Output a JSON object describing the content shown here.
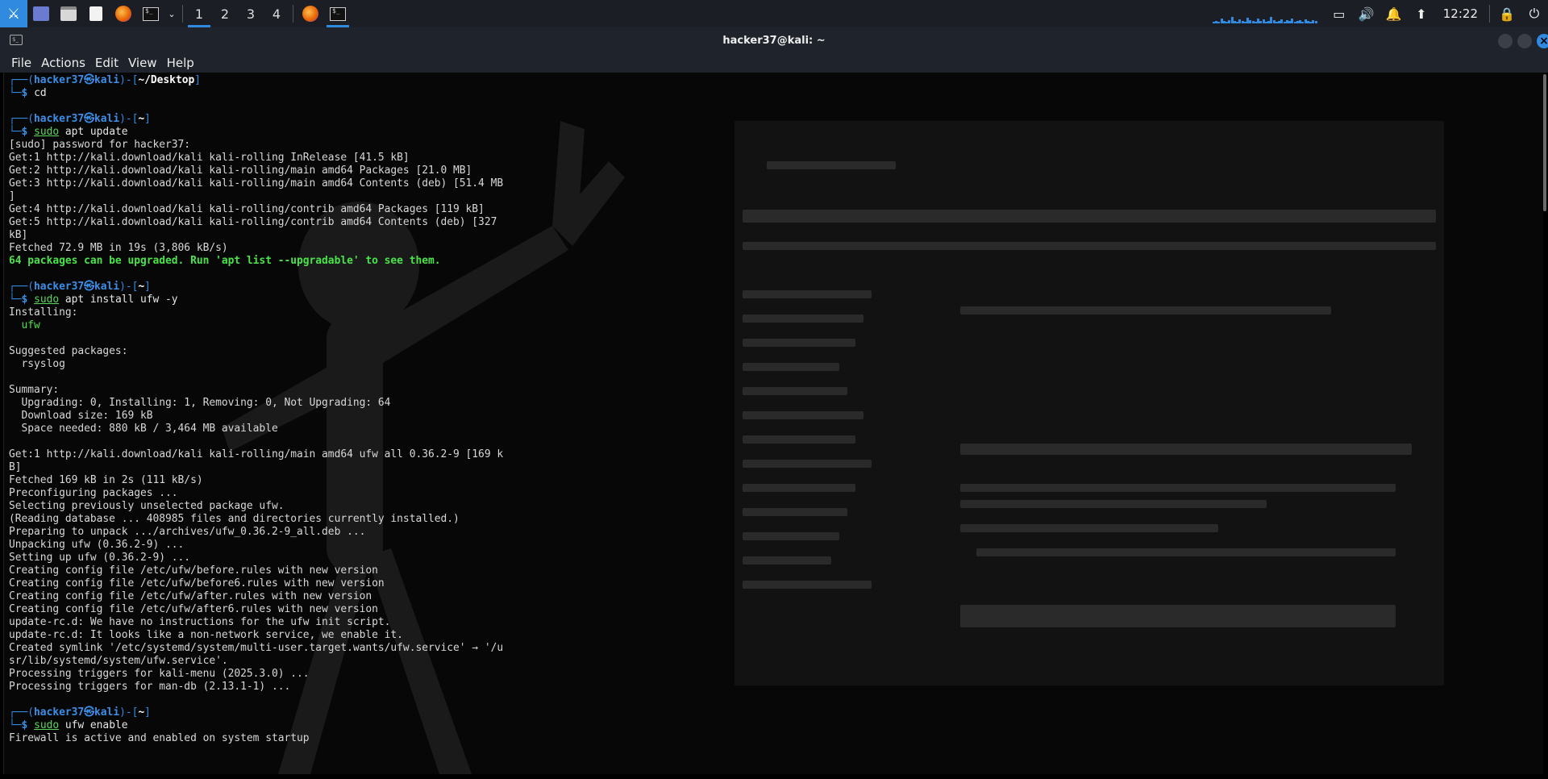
{
  "panel": {
    "workspaces": [
      "1",
      "2",
      "3",
      "4"
    ],
    "active_workspace": "1",
    "clock": "12:22",
    "icons": [
      "kali-menu-icon",
      "desktop-icon",
      "file-manager-icon",
      "text-editor-icon",
      "firefox-icon",
      "terminal-icon",
      "chevron-down-icon"
    ],
    "tray_icons": [
      "display-icon",
      "volume-icon",
      "notification-bell-icon",
      "update-icon",
      "lock-icon",
      "power-icon"
    ]
  },
  "window": {
    "title": "hacker37@kali: ~",
    "menu": [
      "File",
      "Actions",
      "Edit",
      "View",
      "Help"
    ]
  },
  "terminal": {
    "lines": [
      {
        "kind": "prompt-top",
        "user": "hacker37",
        "host": "kali",
        "dir": "~/Desktop"
      },
      {
        "kind": "prompt-cmd",
        "sudo": "",
        "cmd": "cd"
      },
      {
        "kind": "blank"
      },
      {
        "kind": "prompt-top",
        "user": "hacker37",
        "host": "kali",
        "dir": "~"
      },
      {
        "kind": "prompt-cmd",
        "sudo": "sudo",
        "cmd": " apt update"
      },
      {
        "kind": "out",
        "text": "[sudo] password for hacker37:"
      },
      {
        "kind": "out",
        "text": "Get:1 http://kali.download/kali kali-rolling InRelease [41.5 kB]"
      },
      {
        "kind": "out",
        "text": "Get:2 http://kali.download/kali kali-rolling/main amd64 Packages [21.0 MB]"
      },
      {
        "kind": "out",
        "text": "Get:3 http://kali.download/kali kali-rolling/main amd64 Contents (deb) [51.4 MB"
      },
      {
        "kind": "out",
        "text": "]"
      },
      {
        "kind": "out",
        "text": "Get:4 http://kali.download/kali kali-rolling/contrib amd64 Packages [119 kB]"
      },
      {
        "kind": "out",
        "text": "Get:5 http://kali.download/kali kali-rolling/contrib amd64 Contents (deb) [327"
      },
      {
        "kind": "out",
        "text": "kB]"
      },
      {
        "kind": "out",
        "text": "Fetched 72.9 MB in 19s (3,806 kB/s)"
      },
      {
        "kind": "bold-green",
        "text": "64 packages can be upgraded. Run 'apt list --upgradable' to see them."
      },
      {
        "kind": "blank"
      },
      {
        "kind": "prompt-top",
        "user": "hacker37",
        "host": "kali",
        "dir": "~"
      },
      {
        "kind": "prompt-cmd",
        "sudo": "sudo",
        "cmd": " apt install ufw -y"
      },
      {
        "kind": "out",
        "text": "Installing:"
      },
      {
        "kind": "green",
        "text": "  ufw"
      },
      {
        "kind": "blank"
      },
      {
        "kind": "out",
        "text": "Suggested packages:"
      },
      {
        "kind": "out",
        "text": "  rsyslog"
      },
      {
        "kind": "blank"
      },
      {
        "kind": "out",
        "text": "Summary:"
      },
      {
        "kind": "out",
        "text": "  Upgrading: 0, Installing: 1, Removing: 0, Not Upgrading: 64"
      },
      {
        "kind": "out",
        "text": "  Download size: 169 kB"
      },
      {
        "kind": "out",
        "text": "  Space needed: 880 kB / 3,464 MB available"
      },
      {
        "kind": "blank"
      },
      {
        "kind": "out",
        "text": "Get:1 http://kali.download/kali kali-rolling/main amd64 ufw all 0.36.2-9 [169 k"
      },
      {
        "kind": "out",
        "text": "B]"
      },
      {
        "kind": "out",
        "text": "Fetched 169 kB in 2s (111 kB/s)"
      },
      {
        "kind": "out",
        "text": "Preconfiguring packages ..."
      },
      {
        "kind": "out",
        "text": "Selecting previously unselected package ufw."
      },
      {
        "kind": "out",
        "text": "(Reading database ... 408985 files and directories currently installed.)"
      },
      {
        "kind": "out",
        "text": "Preparing to unpack .../archives/ufw_0.36.2-9_all.deb ..."
      },
      {
        "kind": "out",
        "text": "Unpacking ufw (0.36.2-9) ..."
      },
      {
        "kind": "out",
        "text": "Setting up ufw (0.36.2-9) ..."
      },
      {
        "kind": "out",
        "text": "Creating config file /etc/ufw/before.rules with new version"
      },
      {
        "kind": "out",
        "text": "Creating config file /etc/ufw/before6.rules with new version"
      },
      {
        "kind": "out",
        "text": "Creating config file /etc/ufw/after.rules with new version"
      },
      {
        "kind": "out",
        "text": "Creating config file /etc/ufw/after6.rules with new version"
      },
      {
        "kind": "out",
        "text": "update-rc.d: We have no instructions for the ufw init script."
      },
      {
        "kind": "out",
        "text": "update-rc.d: It looks like a non-network service, we enable it."
      },
      {
        "kind": "out",
        "text": "Created symlink '/etc/systemd/system/multi-user.target.wants/ufw.service' → '/u"
      },
      {
        "kind": "out",
        "text": "sr/lib/systemd/system/ufw.service'."
      },
      {
        "kind": "out",
        "text": "Processing triggers for kali-menu (2025.3.0) ..."
      },
      {
        "kind": "out",
        "text": "Processing triggers for man-db (2.13.1-1) ..."
      },
      {
        "kind": "blank"
      },
      {
        "kind": "prompt-top",
        "user": "hacker37",
        "host": "kali",
        "dir": "~"
      },
      {
        "kind": "prompt-cmd",
        "sudo": "sudo",
        "cmd": " ufw enable"
      },
      {
        "kind": "out",
        "text": "Firewall is active and enabled on system startup"
      }
    ]
  },
  "colors": {
    "accent": "#2f8ae0",
    "prompt_green": "#4ae34a",
    "terminal_bg": "#070707",
    "panel_bg": "#1b1e25"
  }
}
